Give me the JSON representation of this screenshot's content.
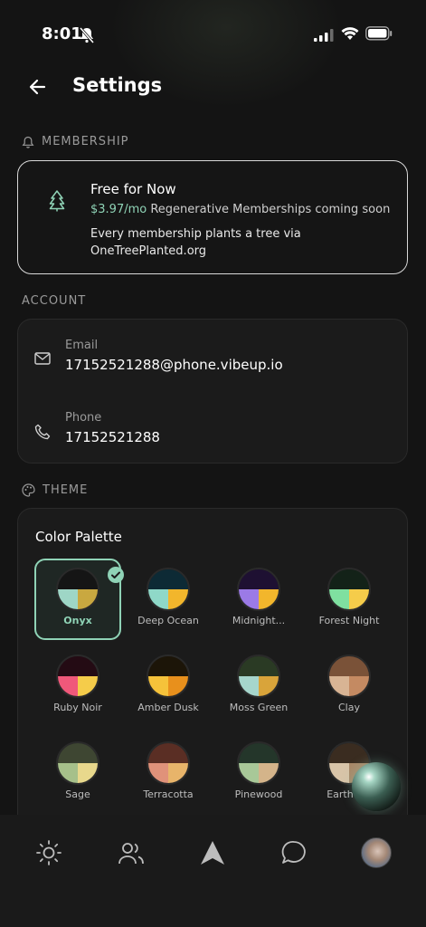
{
  "status_bar": {
    "time": "8:01"
  },
  "header": {
    "title": "Settings"
  },
  "membership": {
    "section_label": "MEMBERSHIP",
    "title": "Free for Now",
    "price": "$3.97/mo",
    "price_note": "Regenerative Memberships coming soon",
    "description": "Every membership plants a tree via OneTreePlanted.org"
  },
  "account": {
    "section_label": "ACCOUNT",
    "email_label": "Email",
    "email_value": "17152521288@phone.vibeup.io",
    "phone_label": "Phone",
    "phone_value": "17152521288"
  },
  "theme": {
    "section_label": "THEME",
    "palette_title": "Color Palette",
    "selected": "Onyx",
    "palettes": [
      {
        "name": "Onyx",
        "top": "#151515",
        "left": "#9ed6c6",
        "right": "#c9a840"
      },
      {
        "name": "Deep Ocean",
        "top": "#0d2a35",
        "left": "#8fd8c8",
        "right": "#f2b62c"
      },
      {
        "name": "Midnight...",
        "top": "#1e1032",
        "left": "#9b7ae6",
        "right": "#f2b62c"
      },
      {
        "name": "Forest Night",
        "top": "#132218",
        "left": "#7fe0a0",
        "right": "#f5cc4a"
      },
      {
        "name": "Ruby Noir",
        "top": "#240b14",
        "left": "#f0587a",
        "right": "#f5cc4a"
      },
      {
        "name": "Amber Dusk",
        "top": "#1c1508",
        "left": "#f5c23a",
        "right": "#e8901c"
      },
      {
        "name": "Moss Green",
        "top": "#2a3a24",
        "left": "#a6d6cc",
        "right": "#d9a43a"
      },
      {
        "name": "Clay",
        "top": "#7a5238",
        "left": "#d8b494",
        "right": "#c48a62"
      },
      {
        "name": "Sage",
        "top": "#3e4632",
        "left": "#a6c08a",
        "right": "#e8d88c"
      },
      {
        "name": "Terracotta",
        "top": "#5a2e24",
        "left": "#e0927a",
        "right": "#e8b46a"
      },
      {
        "name": "Pinewood",
        "top": "#24362a",
        "left": "#a8c898",
        "right": "#d4b48a"
      },
      {
        "name": "Earth L...",
        "top": "#3a2c20",
        "left": "#d8c4a8",
        "right": "#a88868"
      }
    ]
  },
  "tabbar": {
    "items": [
      "sun-icon",
      "people-icon",
      "navigation-arrow-icon",
      "chat-bubble-icon",
      "profile-avatar"
    ]
  }
}
